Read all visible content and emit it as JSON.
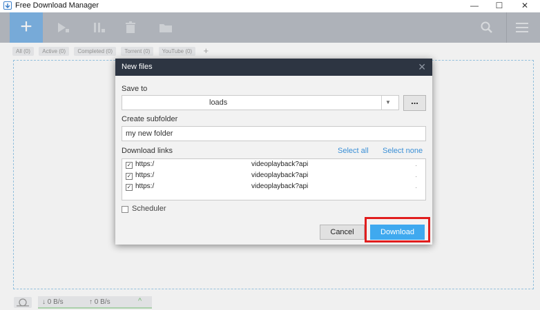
{
  "app": {
    "title": "Free Download Manager"
  },
  "window_controls": {
    "minimize": "—",
    "maximize": "☐",
    "close": "✕"
  },
  "toolbar": {
    "add_label": "+",
    "icons": [
      "play-icon",
      "pause-icon",
      "trash-icon",
      "folder-icon",
      "search-icon",
      "menu-icon"
    ]
  },
  "filters": {
    "tabs": [
      "All (0)",
      "Active (0)",
      "Completed (0)",
      "Torrent (0)",
      "YouTube (0)"
    ],
    "add": "+"
  },
  "status": {
    "down": "↓ 0 B/s",
    "up": "↑ 0 B/s",
    "chevron": "^"
  },
  "dialog": {
    "title": "New files",
    "close": "✕",
    "save_to_label": "Save to",
    "save_to_value": "loads",
    "save_to_arrow": "▼",
    "browse_label": "...",
    "subfolder_label": "Create subfolder",
    "subfolder_value": "my new folder",
    "links_label": "Download links",
    "select_all": "Select all",
    "select_none": "Select none",
    "links": [
      {
        "checked": "✓",
        "start": "https:/",
        "end": "videoplayback?api",
        "tail": "."
      },
      {
        "checked": "✓",
        "start": "https:/",
        "end": "videoplayback?api",
        "tail": "."
      },
      {
        "checked": "✓",
        "start": "https:/",
        "end": "videoplayback?api",
        "tail": "."
      }
    ],
    "scheduler_label": "Scheduler",
    "cancel_label": "Cancel",
    "download_label": "Download"
  },
  "colors": {
    "toolbar": "#b9bec5",
    "accent": "#3fa9ef",
    "dialog_header": "#2d3542",
    "highlight": "#e11d1d"
  }
}
